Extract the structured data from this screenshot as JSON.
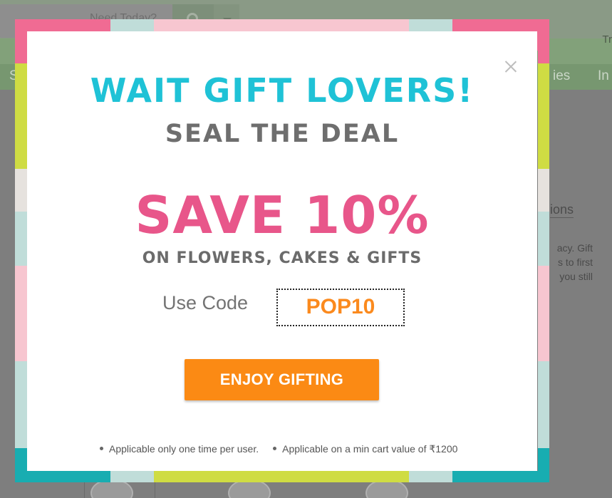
{
  "background": {
    "search_placeholder": "Need Today?",
    "top_right_text": "Tr",
    "nav_left_text": "S",
    "nav_item_partial": "ies",
    "nav_item_partial_2": "In",
    "content_link_partial": "ions",
    "content_paragraph_lines": [
      "acy. Gift",
      "s to first",
      "you still"
    ]
  },
  "modal": {
    "headline": "WAIT GIFT LOVERS!",
    "subheadline": "SEAL THE DEAL",
    "offer": "SAVE 10%",
    "offer_detail": "ON FLOWERS, CAKES & GIFTS",
    "use_code_label": "Use Code",
    "code": "POP10",
    "cta_label": "ENJOY GIFTING",
    "terms": [
      "Applicable only one time per user.",
      "Applicable on a min cart value of ₹1200"
    ],
    "close_icon": "close-icon"
  },
  "colors": {
    "headline": "#1fc2d6",
    "subheadline": "#6e6e6e",
    "offer": "#e8568a",
    "code": "#fb8a1e",
    "cta_background": "#fb8a14",
    "frame_pink": "#f06b93",
    "frame_lime": "#cfdc43",
    "frame_light_pink": "#f7c6d0",
    "frame_light_teal": "#c0ddd9",
    "frame_teal": "#18adb1",
    "frame_light_gray": "#e6e2de"
  }
}
